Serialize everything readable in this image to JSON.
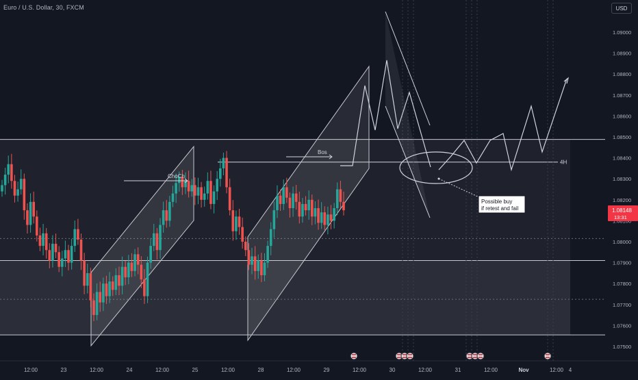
{
  "chart_data": {
    "type": "candlestick",
    "title": "Euro / U.S. Dollar, 30, FXCM",
    "currency": "USD",
    "price_ticks": [
      "1.09000",
      "1.08900",
      "1.08800",
      "1.08700",
      "1.08600",
      "1.08500",
      "1.08400",
      "1.08300",
      "1.08200",
      "1.08100",
      "1.08000",
      "1.07900",
      "1.07800",
      "1.07700",
      "1.07600",
      "1.07500"
    ],
    "time_ticks": [
      "12:00",
      "23",
      "12:00",
      "24",
      "12:00",
      "25",
      "12:00",
      "28",
      "12:00",
      "29",
      "12:00",
      "30",
      "12:00",
      "31",
      "12:00",
      "Nov",
      "12:00",
      "4"
    ],
    "last_price": "1.08148",
    "countdown": "13:31",
    "horizontal_levels": [
      1.08488,
      1.0791,
      1.07555
    ],
    "level_4h": {
      "price": 1.0838,
      "label": "4H"
    },
    "dotted_levels": [
      1.08015,
      1.07725
    ],
    "annotations": {
      "choch": "ChoCh",
      "bos": "Bos",
      "callout": [
        "Possible buy",
        "if retest and fail"
      ]
    },
    "ohlc_close_path": [
      1.0827,
      1.0832,
      1.0837,
      1.0829,
      1.0822,
      1.0825,
      1.083,
      1.0815,
      1.0808,
      1.0819,
      1.0812,
      1.0803,
      1.0798,
      1.0804,
      1.0796,
      1.0791,
      1.0799,
      1.0795,
      1.0788,
      1.0792,
      1.0796,
      1.079,
      1.0798,
      1.0806,
      1.0801,
      1.0791,
      1.0779,
      1.0785,
      1.0772,
      1.0765,
      1.0776,
      1.0771,
      1.078,
      1.0774,
      1.0781,
      1.0777,
      1.0784,
      1.0779,
      1.0788,
      1.0783,
      1.079,
      1.0786,
      1.0794,
      1.0789,
      1.0782,
      1.0774,
      1.079,
      1.0798,
      1.0804,
      1.0796,
      1.0808,
      1.0815,
      1.081,
      1.0819,
      1.0823,
      1.0828,
      1.0831,
      1.0826,
      1.0829,
      1.0824,
      1.0827,
      1.0822,
      1.0826,
      1.082,
      1.0823,
      1.0829,
      1.0818,
      1.0824,
      1.083,
      1.0835,
      1.084,
      1.0826,
      1.0815,
      1.0805,
      1.0812,
      1.0807,
      1.08,
      1.0796,
      1.0789,
      1.0793,
      1.0786,
      1.0791,
      1.0784,
      1.079,
      1.0798,
      1.0806,
      1.0815,
      1.0822,
      1.0818,
      1.0826,
      1.0821,
      1.0816,
      1.0823,
      1.0819,
      1.0812,
      1.0818,
      1.0815,
      1.082,
      1.0812,
      1.0816,
      1.0809,
      1.0814,
      1.0808,
      1.0813,
      1.081,
      1.0816,
      1.0825,
      1.0819,
      1.0815
    ],
    "news_marker_groups": [
      1,
      3,
      3,
      1
    ]
  }
}
